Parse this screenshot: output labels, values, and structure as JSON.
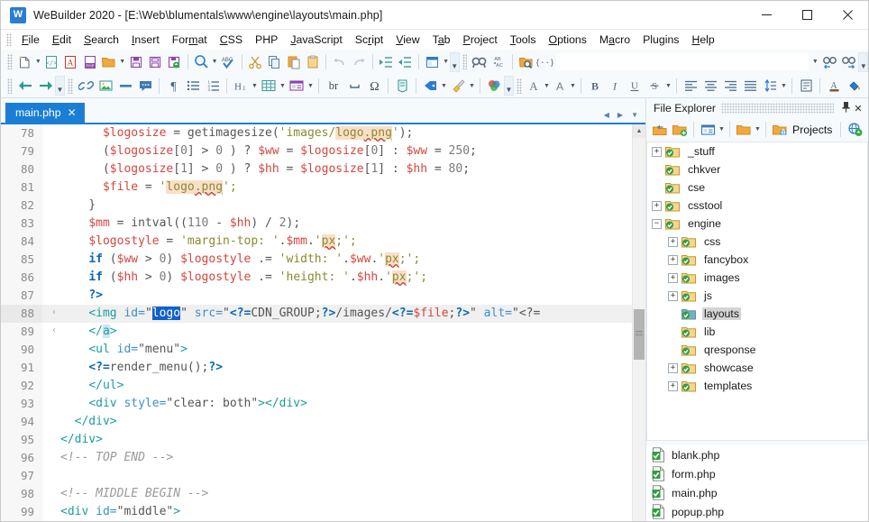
{
  "window": {
    "app_name": "WeBuilder 2020",
    "title": "WeBuilder 2020 - [E:\\Web\\blumentals\\www\\engine\\layouts\\main.php]",
    "icon": "webuilder-logo-icon",
    "minimize": "—",
    "maximize": "☐",
    "close": "✕"
  },
  "menu": {
    "items": [
      {
        "label": "File"
      },
      {
        "label": "Edit"
      },
      {
        "label": "Search"
      },
      {
        "label": "Insert"
      },
      {
        "label": "Format"
      },
      {
        "label": "CSS"
      },
      {
        "label": "PHP"
      },
      {
        "label": "JavaScript"
      },
      {
        "label": "Script"
      },
      {
        "label": "View"
      },
      {
        "label": "Tab"
      },
      {
        "label": "Project"
      },
      {
        "label": "Tools"
      },
      {
        "label": "Options"
      },
      {
        "label": "Macro"
      },
      {
        "label": "Plugins"
      },
      {
        "label": "Help"
      }
    ]
  },
  "toolbar1": {
    "find_value": "",
    "find_placeholder": "",
    "buttons": [
      "new-file-icon",
      "new-from-template-icon",
      "new-html-icon",
      "new-php-icon",
      "open-file-icon",
      "save-icon",
      "save-as-icon",
      "save-all-icon",
      "preview-icon",
      "spellcheck-icon",
      "cut-icon",
      "copy-icon",
      "paste-icon",
      "clipboard-history-icon",
      "undo-icon",
      "redo-icon",
      "indent-icon",
      "outdent-icon",
      "panels-icon",
      "find-icon",
      "replace-icon",
      "find-in-files-icon",
      "code-snippet-icon",
      "find-previous-icon",
      "find-next-icon"
    ]
  },
  "toolbar2": {
    "buttons": [
      "back-icon",
      "forward-icon",
      "hyperlink-icon",
      "image-icon",
      "horizontal-rule-icon",
      "comment-icon",
      "paragraph-icon",
      "unordered-list-icon",
      "ordered-list-icon",
      "heading-icon",
      "table-icon",
      "form-icon",
      "line-break-icon",
      "nbsp-icon",
      "special-character-icon",
      "document-structure-icon",
      "tag-icon",
      "tag-editor-icon",
      "style-brush-icon",
      "color-picker-icon",
      "font-icon",
      "font-size-icon",
      "bold-icon",
      "italic-icon",
      "underline-icon",
      "strikethrough-icon",
      "align-left-icon",
      "align-center-icon",
      "align-right-icon",
      "align-justify-icon",
      "line-height-icon",
      "page-properties-icon",
      "text-color-icon",
      "fill-color-icon"
    ],
    "br_label": "br"
  },
  "tabs": {
    "open": [
      {
        "label": "main.php",
        "close": "✕",
        "active": true
      }
    ],
    "nav": {
      "prev": "◀",
      "next": "▶",
      "list": "▼"
    }
  },
  "editor": {
    "current_line": 88,
    "selection": "logo",
    "lines": [
      {
        "n": "78",
        "fold": false,
        "tokens": [
          {
            "t": "      ",
            "c": ""
          },
          {
            "t": "$logosize",
            "c": "var"
          },
          {
            "t": " = ",
            "c": "pun"
          },
          {
            "t": "getimagesize",
            "c": "pun"
          },
          {
            "t": "(",
            "c": "pun"
          },
          {
            "t": "'images/",
            "c": "str"
          },
          {
            "t": "logo",
            "c": "str misspell"
          },
          {
            "t": ".png",
            "c": "str misspell-u"
          },
          {
            "t": "'",
            "c": "str"
          },
          {
            "t": ");",
            "c": "pun"
          }
        ]
      },
      {
        "n": "79",
        "fold": false,
        "tokens": [
          {
            "t": "      (",
            "c": "pun"
          },
          {
            "t": "$logosize",
            "c": "var"
          },
          {
            "t": "[",
            "c": "pun"
          },
          {
            "t": "0",
            "c": "num"
          },
          {
            "t": "] > ",
            "c": "pun"
          },
          {
            "t": "0",
            "c": "num"
          },
          {
            "t": " ) ? ",
            "c": "pun"
          },
          {
            "t": "$ww",
            "c": "var"
          },
          {
            "t": " = ",
            "c": "pun"
          },
          {
            "t": "$logosize",
            "c": "var"
          },
          {
            "t": "[",
            "c": "pun"
          },
          {
            "t": "0",
            "c": "num"
          },
          {
            "t": "] : ",
            "c": "pun"
          },
          {
            "t": "$ww",
            "c": "var"
          },
          {
            "t": " = ",
            "c": "pun"
          },
          {
            "t": "250",
            "c": "num"
          },
          {
            "t": ";",
            "c": "pun"
          }
        ]
      },
      {
        "n": "80",
        "fold": false,
        "tokens": [
          {
            "t": "      (",
            "c": "pun"
          },
          {
            "t": "$logosize",
            "c": "var"
          },
          {
            "t": "[",
            "c": "pun"
          },
          {
            "t": "1",
            "c": "num"
          },
          {
            "t": "] > ",
            "c": "pun"
          },
          {
            "t": "0",
            "c": "num"
          },
          {
            "t": " ) ? ",
            "c": "pun"
          },
          {
            "t": "$hh",
            "c": "var"
          },
          {
            "t": " = ",
            "c": "pun"
          },
          {
            "t": "$logosize",
            "c": "var"
          },
          {
            "t": "[",
            "c": "pun"
          },
          {
            "t": "1",
            "c": "num"
          },
          {
            "t": "] : ",
            "c": "pun"
          },
          {
            "t": "$hh",
            "c": "var"
          },
          {
            "t": " = ",
            "c": "pun"
          },
          {
            "t": "80",
            "c": "num"
          },
          {
            "t": ";",
            "c": "pun"
          }
        ]
      },
      {
        "n": "81",
        "fold": false,
        "tokens": [
          {
            "t": "      ",
            "c": ""
          },
          {
            "t": "$file",
            "c": "var"
          },
          {
            "t": " = ",
            "c": "pun"
          },
          {
            "t": "'",
            "c": "str"
          },
          {
            "t": "logo",
            "c": "str misspell"
          },
          {
            "t": ".png",
            "c": "str misspell-u"
          },
          {
            "t": "';",
            "c": "str"
          }
        ]
      },
      {
        "n": "82",
        "fold": false,
        "tokens": [
          {
            "t": "    }",
            "c": "pun"
          }
        ]
      },
      {
        "n": "83",
        "fold": false,
        "tokens": [
          {
            "t": "    ",
            "c": ""
          },
          {
            "t": "$mm",
            "c": "var"
          },
          {
            "t": " = ",
            "c": "pun"
          },
          {
            "t": "intval",
            "c": "pun"
          },
          {
            "t": "((",
            "c": "pun"
          },
          {
            "t": "110",
            "c": "num"
          },
          {
            "t": " - ",
            "c": "pun"
          },
          {
            "t": "$hh",
            "c": "var"
          },
          {
            "t": ") / ",
            "c": "pun"
          },
          {
            "t": "2",
            "c": "num"
          },
          {
            "t": ");",
            "c": "pun"
          }
        ]
      },
      {
        "n": "84",
        "fold": false,
        "tokens": [
          {
            "t": "    ",
            "c": ""
          },
          {
            "t": "$logostyle",
            "c": "var"
          },
          {
            "t": " = ",
            "c": "pun"
          },
          {
            "t": "'margin-top: '",
            "c": "str"
          },
          {
            "t": ".",
            "c": "pun"
          },
          {
            "t": "$mm",
            "c": "var"
          },
          {
            "t": ".",
            "c": "pun"
          },
          {
            "t": "'",
            "c": "str"
          },
          {
            "t": "px",
            "c": "str misspell-u"
          },
          {
            "t": ";';",
            "c": "str"
          }
        ]
      },
      {
        "n": "85",
        "fold": false,
        "tokens": [
          {
            "t": "    ",
            "c": ""
          },
          {
            "t": "if",
            "c": "k"
          },
          {
            "t": " (",
            "c": "pun"
          },
          {
            "t": "$ww",
            "c": "var"
          },
          {
            "t": " > ",
            "c": "pun"
          },
          {
            "t": "0",
            "c": "num"
          },
          {
            "t": ") ",
            "c": "pun"
          },
          {
            "t": "$logostyle",
            "c": "var"
          },
          {
            "t": " .= ",
            "c": "pun"
          },
          {
            "t": "'width: '",
            "c": "str"
          },
          {
            "t": ".",
            "c": "pun"
          },
          {
            "t": "$ww",
            "c": "var"
          },
          {
            "t": ".",
            "c": "pun"
          },
          {
            "t": "'",
            "c": "str"
          },
          {
            "t": "px",
            "c": "str misspell-u"
          },
          {
            "t": ";';",
            "c": "str"
          }
        ]
      },
      {
        "n": "86",
        "fold": false,
        "tokens": [
          {
            "t": "    ",
            "c": ""
          },
          {
            "t": "if",
            "c": "k"
          },
          {
            "t": " (",
            "c": "pun"
          },
          {
            "t": "$hh",
            "c": "var"
          },
          {
            "t": " > ",
            "c": "pun"
          },
          {
            "t": "0",
            "c": "num"
          },
          {
            "t": ") ",
            "c": "pun"
          },
          {
            "t": "$logostyle",
            "c": "var"
          },
          {
            "t": " .= ",
            "c": "pun"
          },
          {
            "t": "'height: '",
            "c": "str"
          },
          {
            "t": ".",
            "c": "pun"
          },
          {
            "t": "$hh",
            "c": "var"
          },
          {
            "t": ".",
            "c": "pun"
          },
          {
            "t": "'",
            "c": "str"
          },
          {
            "t": "px",
            "c": "str misspell-u"
          },
          {
            "t": ";';",
            "c": "str"
          }
        ]
      },
      {
        "n": "87",
        "fold": false,
        "tokens": [
          {
            "t": "    ",
            "c": ""
          },
          {
            "t": "?>",
            "c": "php"
          }
        ]
      },
      {
        "n": "88",
        "fold": true,
        "current": true,
        "tokens": [
          {
            "t": "    ",
            "c": ""
          },
          {
            "t": "<img",
            "c": "tag"
          },
          {
            "t": " id=",
            "c": "att"
          },
          {
            "t": "\"",
            "c": "pun"
          },
          {
            "t": "logo",
            "c": "sel"
          },
          {
            "t": "\"",
            "c": "pun"
          },
          {
            "t": " src=",
            "c": "att"
          },
          {
            "t": "\"",
            "c": "pun"
          },
          {
            "t": "<?=",
            "c": "php"
          },
          {
            "t": "CDN_GROUP",
            "c": "pun"
          },
          {
            "t": ";",
            "c": "pun"
          },
          {
            "t": "?>",
            "c": "php"
          },
          {
            "t": "/images/",
            "c": "pun"
          },
          {
            "t": "<?=",
            "c": "php"
          },
          {
            "t": "$file",
            "c": "var"
          },
          {
            "t": ";",
            "c": "pun"
          },
          {
            "t": "?>",
            "c": "php"
          },
          {
            "t": "\"",
            "c": "pun"
          },
          {
            "t": " alt=",
            "c": "att"
          },
          {
            "t": "\"<?=",
            "c": "pun"
          }
        ]
      },
      {
        "n": "89",
        "fold": true,
        "tokens": [
          {
            "t": "    ",
            "c": ""
          },
          {
            "t": "</",
            "c": "tag"
          },
          {
            "t": "a",
            "c": "tag selq"
          },
          {
            "t": ">",
            "c": "tag"
          }
        ]
      },
      {
        "n": "90",
        "fold": false,
        "tokens": [
          {
            "t": "    ",
            "c": ""
          },
          {
            "t": "<ul",
            "c": "tag"
          },
          {
            "t": " id=",
            "c": "att"
          },
          {
            "t": "\"menu\"",
            "c": "pun"
          },
          {
            "t": ">",
            "c": "tag"
          }
        ]
      },
      {
        "n": "91",
        "fold": false,
        "tokens": [
          {
            "t": "    ",
            "c": ""
          },
          {
            "t": "<?=",
            "c": "php"
          },
          {
            "t": "render_menu",
            "c": "pun"
          },
          {
            "t": "();",
            "c": "pun"
          },
          {
            "t": "?>",
            "c": "php"
          }
        ]
      },
      {
        "n": "92",
        "fold": false,
        "tokens": [
          {
            "t": "    ",
            "c": ""
          },
          {
            "t": "</ul>",
            "c": "tag"
          }
        ]
      },
      {
        "n": "93",
        "fold": false,
        "tokens": [
          {
            "t": "    ",
            "c": ""
          },
          {
            "t": "<div",
            "c": "tag"
          },
          {
            "t": " style=",
            "c": "att"
          },
          {
            "t": "\"clear: both\"",
            "c": "pun"
          },
          {
            "t": ">",
            "c": "tag"
          },
          {
            "t": "</div>",
            "c": "tag"
          }
        ]
      },
      {
        "n": "94",
        "fold": false,
        "tokens": [
          {
            "t": "  ",
            "c": ""
          },
          {
            "t": "</div>",
            "c": "tag"
          }
        ]
      },
      {
        "n": "95",
        "fold": false,
        "tokens": [
          {
            "t": "</div>",
            "c": "tag"
          }
        ]
      },
      {
        "n": "96",
        "fold": false,
        "tokens": [
          {
            "t": "<!-- TOP END -->",
            "c": "cmt"
          }
        ]
      },
      {
        "n": "97",
        "fold": false,
        "tokens": [
          {
            "t": "",
            "c": ""
          }
        ]
      },
      {
        "n": "98",
        "fold": false,
        "tokens": [
          {
            "t": "<!-- MIDDLE BEGIN -->",
            "c": "cmt"
          }
        ]
      },
      {
        "n": "99",
        "fold": false,
        "tokens": [
          {
            "t": "<div",
            "c": "tag"
          },
          {
            "t": " id=",
            "c": "att"
          },
          {
            "t": "\"middle\"",
            "c": "pun"
          },
          {
            "t": ">",
            "c": "tag"
          }
        ]
      }
    ]
  },
  "file_explorer": {
    "title": "File Explorer",
    "pin": "📌",
    "close": "✕",
    "toolbar": {
      "buttons": [
        "open-folder-icon",
        "new-folder-icon",
        "view-mode-icon",
        "folder-icon",
        "projects-icon",
        "web-upload-icon"
      ],
      "projects_label": "Projects"
    },
    "tree": [
      {
        "label": "_stuff",
        "indent": 0,
        "expander": "+",
        "selected": false
      },
      {
        "label": "chkver",
        "indent": 0,
        "expander": "",
        "selected": false
      },
      {
        "label": "cse",
        "indent": 0,
        "expander": "",
        "selected": false
      },
      {
        "label": "csstool",
        "indent": 0,
        "expander": "+",
        "selected": false
      },
      {
        "label": "engine",
        "indent": 0,
        "expander": "−",
        "selected": false
      },
      {
        "label": "css",
        "indent": 1,
        "expander": "+",
        "selected": false
      },
      {
        "label": "fancybox",
        "indent": 1,
        "expander": "+",
        "selected": false
      },
      {
        "label": "images",
        "indent": 1,
        "expander": "+",
        "selected": false
      },
      {
        "label": "js",
        "indent": 1,
        "expander": "+",
        "selected": false
      },
      {
        "label": "layouts",
        "indent": 1,
        "expander": "",
        "selected": true
      },
      {
        "label": "lib",
        "indent": 1,
        "expander": "",
        "selected": false
      },
      {
        "label": "qresponse",
        "indent": 1,
        "expander": "",
        "selected": false
      },
      {
        "label": "showcase",
        "indent": 1,
        "expander": "+",
        "selected": false
      },
      {
        "label": "templates",
        "indent": 1,
        "expander": "+",
        "selected": false
      }
    ],
    "files": [
      {
        "label": "blank.php"
      },
      {
        "label": "form.php"
      },
      {
        "label": "main.php"
      },
      {
        "label": "popup.php"
      }
    ]
  },
  "colors": {
    "accent": "#1a7fd4",
    "toolbar_bg": "#f7fafd",
    "selection": "#1260c9",
    "current_line": "#f0f0f0",
    "folder": "#f6d68f",
    "checkmark_green": "#2e9e3e"
  }
}
